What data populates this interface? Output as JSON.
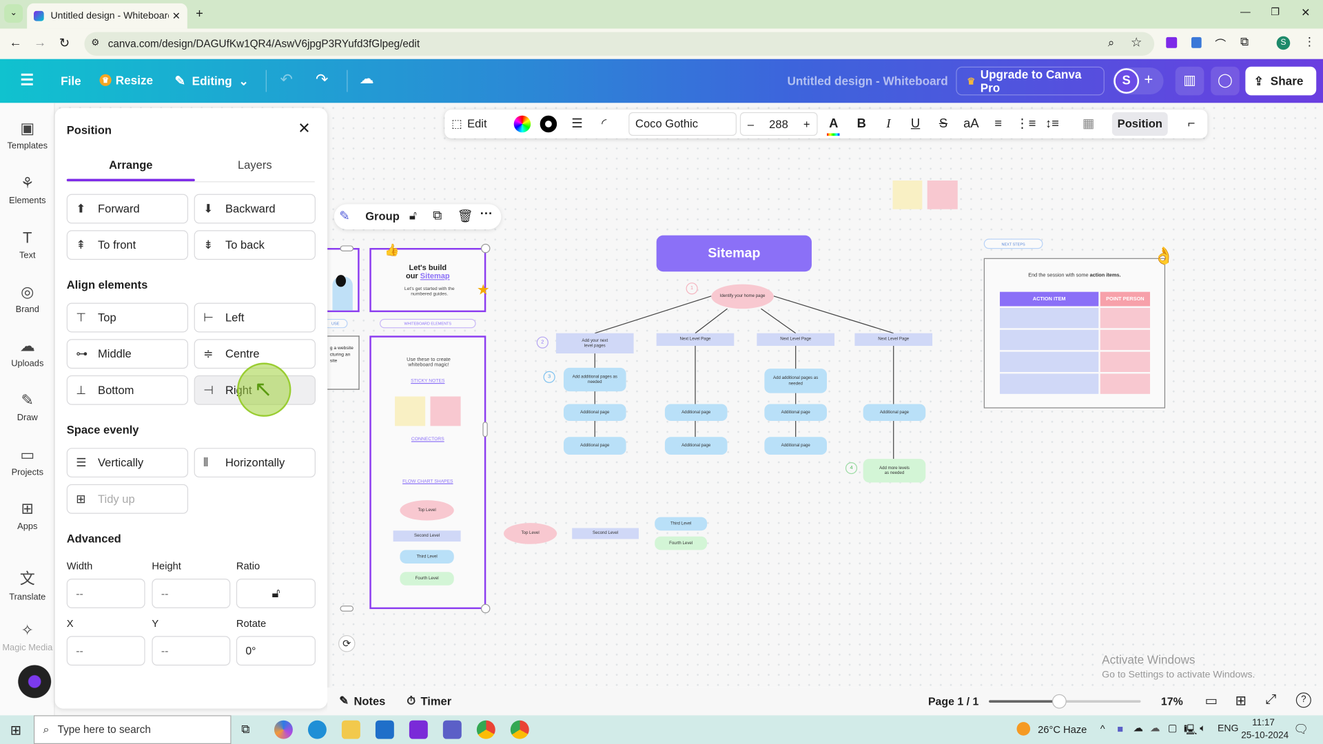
{
  "browser": {
    "tab_title": "Untitled design - Whiteboard -",
    "url": "canva.com/design/DAGUfKw1QR4/AswV6jpgP3RYufd3fGlpeg/edit"
  },
  "header": {
    "file": "File",
    "resize": "Resize",
    "editing": "Editing",
    "doc_title": "Untitled design - Whiteboard",
    "upgrade": "Upgrade to Canva Pro",
    "avatar": "S",
    "share": "Share"
  },
  "sidebar": {
    "items": [
      {
        "label": "Templates",
        "icon": "templates-icon"
      },
      {
        "label": "Elements",
        "icon": "elements-icon"
      },
      {
        "label": "Text",
        "icon": "text-icon"
      },
      {
        "label": "Brand",
        "icon": "brand-icon"
      },
      {
        "label": "Uploads",
        "icon": "uploads-icon"
      },
      {
        "label": "Draw",
        "icon": "draw-icon"
      },
      {
        "label": "Projects",
        "icon": "projects-icon"
      },
      {
        "label": "Apps",
        "icon": "apps-icon"
      },
      {
        "label": "Translate",
        "icon": "translate-icon"
      },
      {
        "label": "Magic Media",
        "icon": "magic-media-icon"
      }
    ]
  },
  "panel": {
    "title": "Position",
    "tabs": [
      "Arrange",
      "Layers"
    ],
    "active_tab": "Arrange",
    "arrange": [
      "Forward",
      "Backward",
      "To front",
      "To back"
    ],
    "align_title": "Align elements",
    "align": [
      "Top",
      "Left",
      "Middle",
      "Centre",
      "Bottom",
      "Right"
    ],
    "space_title": "Space evenly",
    "space": [
      "Vertically",
      "Horizontally",
      "Tidy up"
    ],
    "advanced_title": "Advanced",
    "width_label": "Width",
    "height_label": "Height",
    "ratio_label": "Ratio",
    "x_label": "X",
    "y_label": "Y",
    "rotate_label": "Rotate",
    "width": "--",
    "height": "--",
    "x": "--",
    "y": "--",
    "rotate": "0°"
  },
  "toolbar": {
    "edit": "Edit",
    "font": "Coco Gothic",
    "font_size": "288",
    "position": "Position"
  },
  "group_bar": {
    "group": "Group"
  },
  "canvas": {
    "frame2": {
      "title1": "Let's build",
      "title2": "our ",
      "link": "Sitemap",
      "sub": "Let's get started with the numbered guides."
    },
    "pill1": "USE",
    "pill2": "WHITEBOARD ELEMENTS",
    "frame3_text": "g a website cturing an site",
    "frame4": {
      "intro": "Use these to create whiteboard magic!",
      "sticky": "STICKY NOTES",
      "connectors": "CONNECTORS",
      "flow": "FLOW CHART SHAPES",
      "shapes": [
        "Top Level",
        "Second Level",
        "Third Level",
        "Fourth Level"
      ]
    },
    "sitemap": {
      "title": "Sitemap",
      "home": "Identify your home page",
      "level": [
        "Add your next level pages",
        "Next Level Page",
        "Next Level Page",
        "Next Level Page"
      ],
      "add_additional": "Add additional pages as needed",
      "additional": "Additional page",
      "more": "Add more levels as needed",
      "nums": [
        "1",
        "2",
        "3",
        "4"
      ]
    },
    "legend": [
      "Top Level",
      "Second Level",
      "Third Level",
      "Fourth Level"
    ],
    "next_steps": {
      "pill": "NEXT STEPS",
      "text_pre": "End the session with some ",
      "text_bold": "action items.",
      "col1": "ACTION ITEM",
      "col2": "POINT PERSON"
    },
    "watermark1": "Activate Windows",
    "watermark2": "Go to Settings to activate Windows."
  },
  "bottom": {
    "notes": "Notes",
    "timer": "Timer",
    "page": "Page 1 / 1",
    "zoom": "17%",
    "zoom_value": 17
  },
  "taskbar": {
    "search": "Type here to search",
    "weather": "26°C  Haze",
    "lang": "ENG",
    "time": "11:17",
    "date": "25-10-2024"
  },
  "colors": {
    "accent": "#8b3cf0",
    "sitemap": "#8b70f7",
    "lavender": "#d0d8f7",
    "blue": "#b9e0f8",
    "pink": "#f8c8d0",
    "green": "#d3f5d6"
  }
}
